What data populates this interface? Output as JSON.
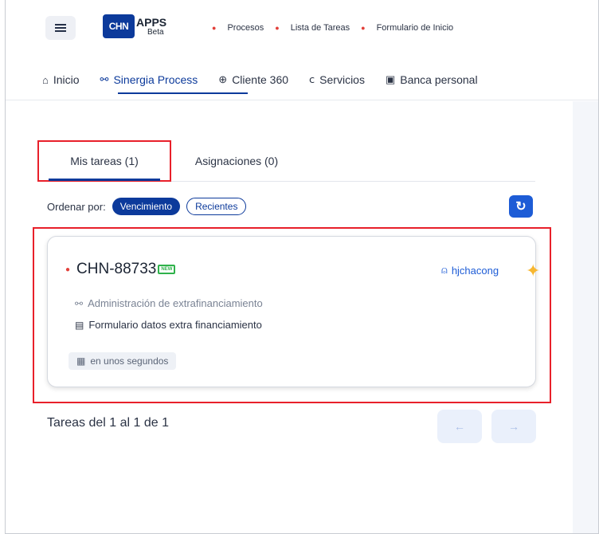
{
  "header": {
    "logo_mark": "CHN",
    "logo_text": "APPS",
    "logo_beta": "Beta",
    "breadcrumb": [
      "Procesos",
      "Lista de Tareas",
      "Formulario de Inicio"
    ]
  },
  "nav": {
    "items": [
      {
        "label": "Inicio",
        "icon": "home-icon"
      },
      {
        "label": "Sinergia Process",
        "icon": "process-icon",
        "active": true
      },
      {
        "label": "Cliente 360",
        "icon": "target-icon"
      },
      {
        "label": "Servicios",
        "icon": "services-icon"
      },
      {
        "label": "Banca personal",
        "icon": "bank-icon"
      }
    ]
  },
  "tabs": [
    {
      "label": "Mis tareas (1)",
      "active": true
    },
    {
      "label": "Asignaciones (0)",
      "active": false
    }
  ],
  "order": {
    "label": "Ordenar por:",
    "options": [
      {
        "label": "Vencimiento",
        "active": true
      },
      {
        "label": "Recientes",
        "active": false
      }
    ]
  },
  "task": {
    "id": "CHN-88733",
    "badge": "NEW",
    "assignee": "hjchacong",
    "process": "Administración de extrafinanciamiento",
    "form": "Formulario datos extra financiamiento",
    "due": "en unos segundos"
  },
  "pagination": {
    "text": "Tareas del 1 al 1 de 1"
  },
  "colors": {
    "accent": "#0c3a9b",
    "highlight": "#e8202a",
    "new_badge": "#2fb24b"
  }
}
